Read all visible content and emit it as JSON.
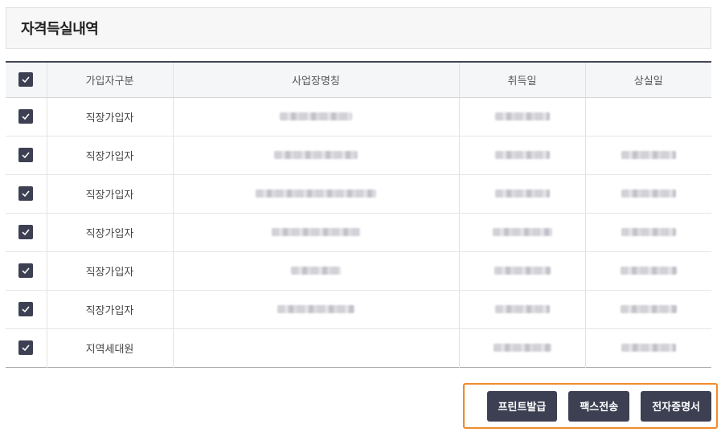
{
  "title": "자격득실내역",
  "columns": [
    "가입자구분",
    "사업장명칭",
    "취득일",
    "상실일"
  ],
  "rows": [
    {
      "type": "직장가입자"
    },
    {
      "type": "직장가입자"
    },
    {
      "type": "직장가입자"
    },
    {
      "type": "직장가입자"
    },
    {
      "type": "직장가입자"
    },
    {
      "type": "직장가입자"
    },
    {
      "type": "지역세대원"
    }
  ],
  "buttons": {
    "print": "프린트발급",
    "fax": "팩스전송",
    "digital": "전자증명서"
  },
  "colors": {
    "accent": "#3d4052",
    "highlight": "#f08a2c"
  },
  "icons": {
    "checkbox": "check-icon"
  }
}
